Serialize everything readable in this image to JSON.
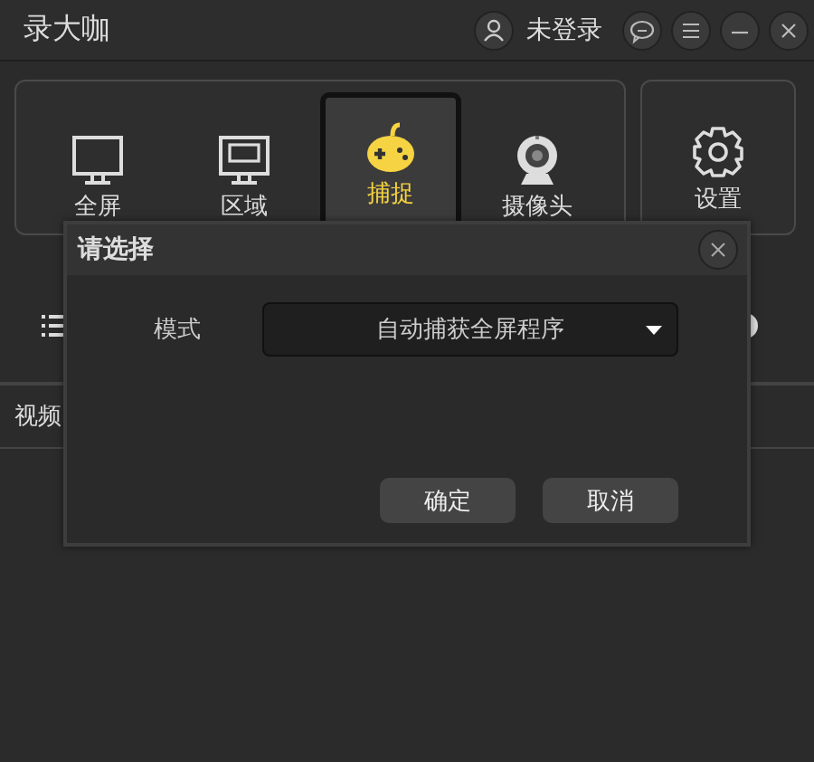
{
  "window": {
    "title": "录大咖"
  },
  "account": {
    "label": "未登录"
  },
  "modes": [
    {
      "label": "全屏",
      "kind": "monitor",
      "selected": false
    },
    {
      "label": "区域",
      "kind": "region",
      "selected": false
    },
    {
      "label": "捕捉",
      "kind": "gamepad",
      "selected": true
    },
    {
      "label": "摄像头",
      "kind": "webcam",
      "selected": false
    }
  ],
  "settings": {
    "label": "设置"
  },
  "section_label": "视频",
  "dialog": {
    "title": "请选择",
    "field": {
      "label": "模式",
      "value": "自动捕获全屏程序"
    },
    "buttons": [
      "确定",
      "取消"
    ]
  }
}
